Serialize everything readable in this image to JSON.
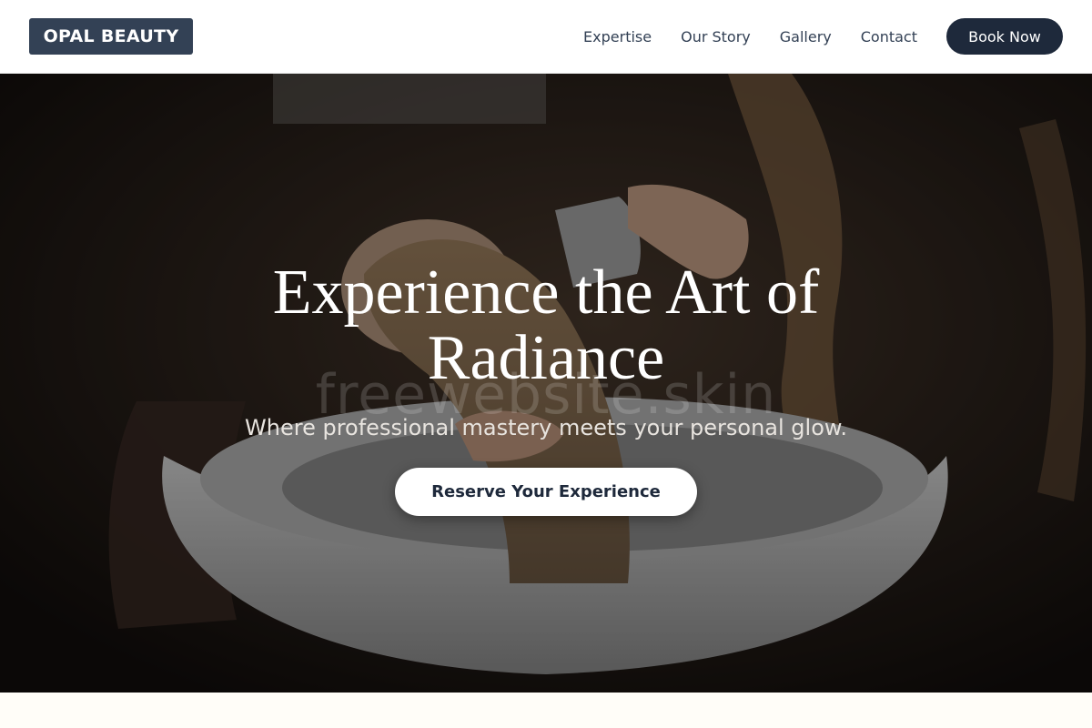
{
  "brand": {
    "logo_text": "OPAL BEAUTY"
  },
  "nav": {
    "links": [
      "Expertise",
      "Our Story",
      "Gallery",
      "Contact"
    ],
    "book_label": "Book Now"
  },
  "hero": {
    "title": "Experience the Art of Radiance",
    "subtitle": "Where professional mastery meets your personal glow.",
    "cta_label": "Reserve Your Experience",
    "watermark": "freewebsite.skin"
  },
  "colors": {
    "primary": "#1e293b",
    "logo_bg": "#334155",
    "page_bg": "#fffdf8"
  }
}
